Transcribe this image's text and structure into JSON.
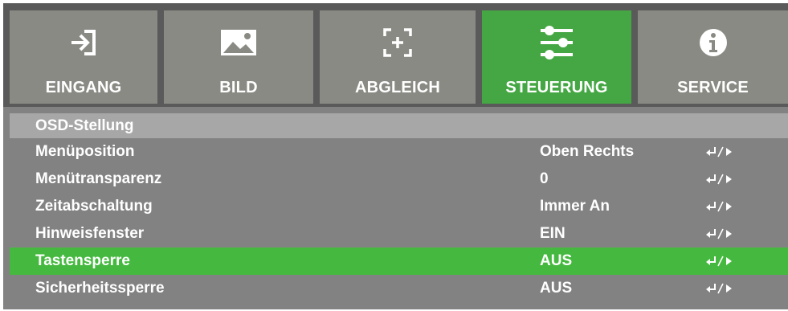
{
  "tabs": [
    {
      "label": "EINGANG",
      "icon": "input-icon"
    },
    {
      "label": "BILD",
      "icon": "image-icon"
    },
    {
      "label": "ABGLEICH",
      "icon": "alignment-icon"
    },
    {
      "label": "STEUERUNG",
      "icon": "sliders-icon",
      "active": true
    },
    {
      "label": "SERVICE",
      "icon": "info-icon"
    }
  ],
  "section": {
    "title": "OSD-Stellung"
  },
  "rows": [
    {
      "label": "Menüposition",
      "value": "Oben Rechts"
    },
    {
      "label": "Menütransparenz",
      "value": "0"
    },
    {
      "label": "Zeitabschaltung",
      "value": "Immer An"
    },
    {
      "label": "Hinweisfenster",
      "value": "EIN"
    },
    {
      "label": "Tastensperre",
      "value": "AUS",
      "selected": true
    },
    {
      "label": "Sicherheitssperre",
      "value": "AUS"
    }
  ],
  "colors": {
    "active_tab": "#45a744",
    "selected_row": "#45b93f",
    "panel": "#828282",
    "tab_bg": "#8a8a84",
    "header_bar": "#a7a7a7"
  }
}
